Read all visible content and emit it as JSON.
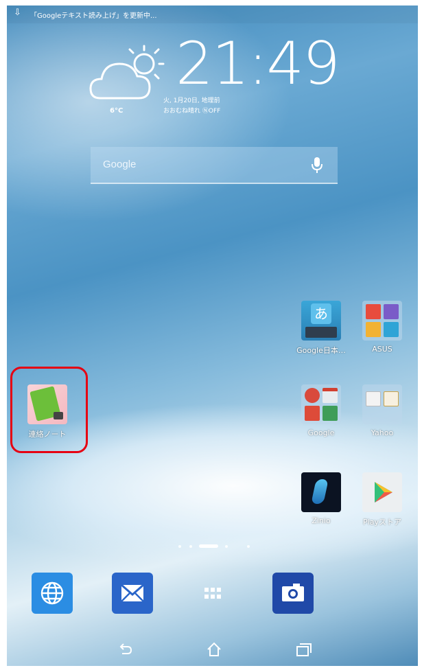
{
  "status_bar": {
    "notification_text": "「Googleテキスト読み上げ」を更新中..."
  },
  "weather": {
    "temperature": "6°C",
    "time": "21:49",
    "date": "火, 1月20日, 地理前",
    "forecast": "おおむね晴れ ⓃOFF"
  },
  "search": {
    "label": "Google"
  },
  "apps": {
    "google_japanese": "Google日本…",
    "asus": "ASUS",
    "google_folder": "Google",
    "yahoo": "Yahoo",
    "zinio": "Zinio",
    "play_store": "Playストア",
    "renraku": "連絡ノート"
  },
  "colors": {
    "highlight": "#e60012",
    "dock_browser": "#2b8de3",
    "dock_email": "#2a65c9",
    "dock_camera": "#2049a8"
  },
  "icons": [
    "download-icon",
    "weather-cloud-sun-icon",
    "mic-icon",
    "globe-icon",
    "mail-icon",
    "apps-grid-icon",
    "camera-icon",
    "back-icon",
    "home-icon",
    "recents-icon"
  ]
}
